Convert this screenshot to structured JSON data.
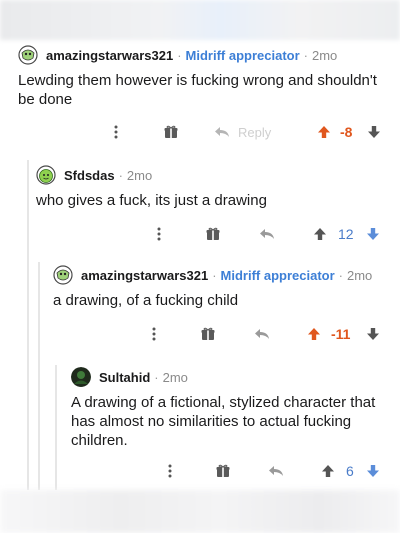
{
  "comments": [
    {
      "user": "amazingstarwars321",
      "flair": "Midriff appreciator",
      "age": "2mo",
      "body": "Lewding them however is fucking wrong and shouldn't be done",
      "reply_label": "Reply",
      "score": "-8",
      "vote_state": "upvoted"
    },
    {
      "user": "Sfdsdas",
      "age": "2mo",
      "body": "who gives a fuck, its just a drawing",
      "score": "12",
      "vote_state": "none"
    },
    {
      "user": "amazingstarwars321",
      "flair": "Midriff appreciator",
      "age": "2mo",
      "body": "a drawing, of a fucking child",
      "score": "-11",
      "vote_state": "upvoted"
    },
    {
      "user": "Sultahid",
      "age": "2mo",
      "body": "A drawing of a fictional, stylized character that has almost no similarities to actual fucking children.",
      "score": "6",
      "vote_state": "none"
    }
  ],
  "separator": "·",
  "icons": [
    "more-vertical-icon",
    "gift-icon",
    "reply-icon",
    "upvote-icon",
    "downvote-icon"
  ],
  "colors": {
    "flair": "#3d7fd6",
    "upvoted": "#e0571e",
    "downvote": "#5b8dd9",
    "icon": "#6a6a6a"
  }
}
